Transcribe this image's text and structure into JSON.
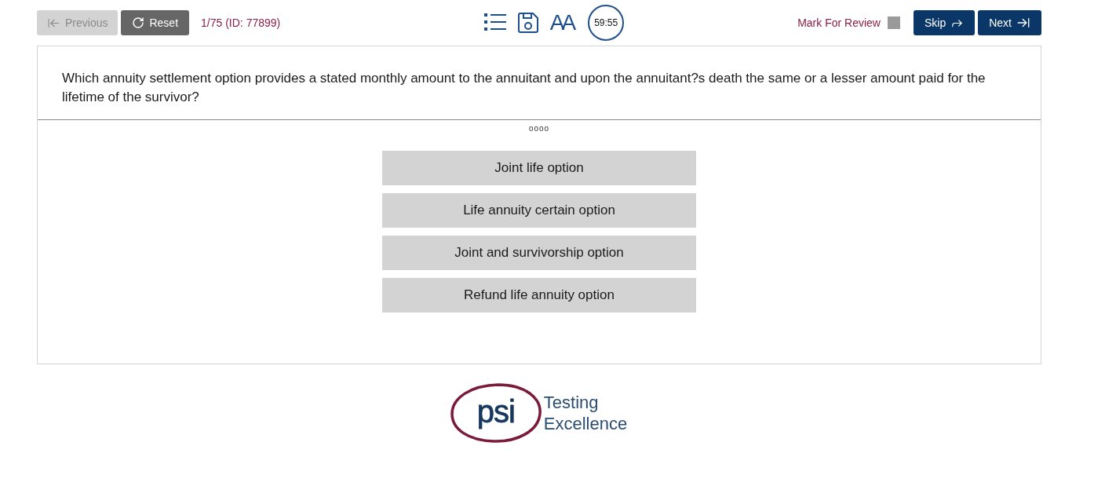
{
  "toolbar": {
    "previous": {
      "label": "Previous",
      "disabled": true
    },
    "reset": {
      "label": "Reset"
    },
    "progress": "1/75 (ID: 77899)",
    "font_size_button": "AA",
    "timer": "59:55",
    "mark_for_review": {
      "label": "Mark For Review",
      "checked": false
    },
    "skip": {
      "label": "Skip"
    },
    "next": {
      "label": "Next"
    }
  },
  "question": {
    "text": "Which annuity settlement option provides a stated monthly amount to the annuitant and upon the annuitant?s death the same or a lesser amount paid for the lifetime of the survivor?",
    "indicator": "oooo",
    "options": [
      {
        "label": "Joint life option",
        "selected": false
      },
      {
        "label": "Life annuity certain option",
        "selected": false
      },
      {
        "label": "Joint and survivorship option",
        "selected": false
      },
      {
        "label": "Refund life annuity option",
        "selected": false
      }
    ]
  },
  "footer_logo": {
    "mark": "psi",
    "tagline": [
      "Testing",
      "Excellence"
    ]
  }
}
